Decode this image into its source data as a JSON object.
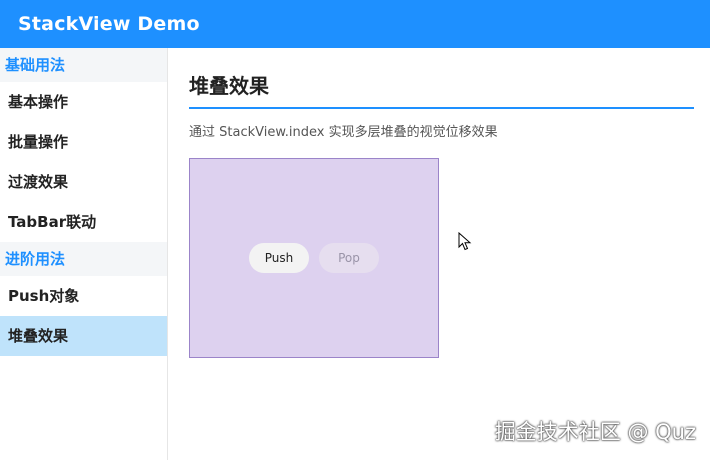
{
  "app": {
    "title": "StackView Demo"
  },
  "sidebar": {
    "groups": [
      {
        "header": "基础用法",
        "items": [
          "基本操作",
          "批量操作",
          "过渡效果",
          "TabBar联动"
        ]
      },
      {
        "header": "进阶用法",
        "items": [
          "Push对象",
          "堆叠效果"
        ]
      }
    ],
    "active_item": "堆叠效果"
  },
  "main": {
    "title": "堆叠效果",
    "description": "通过 StackView.index 实现多层堆叠的视觉位移效果",
    "demo": {
      "push_label": "Push",
      "pop_label": "Pop"
    }
  },
  "watermark": "掘金技术社区 @ Quz",
  "colors": {
    "accent": "#1e90ff",
    "active_item_bg": "#bfe3fb",
    "demo_bg": "#ddd1ef"
  }
}
